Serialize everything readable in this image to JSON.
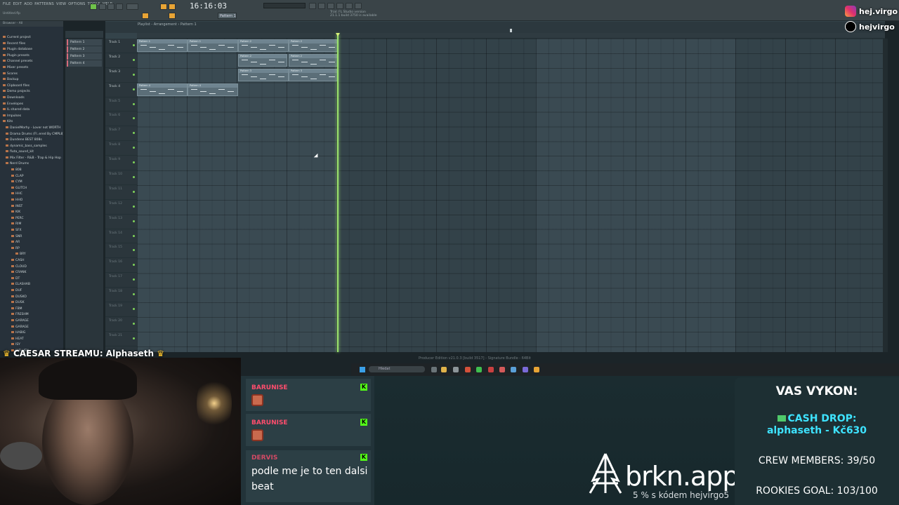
{
  "toolbar": {
    "menu": [
      "FILE",
      "EDIT",
      "ADD",
      "PATTERNS",
      "VIEW",
      "OPTIONS",
      "TOOLS",
      "HELP"
    ],
    "time": "16:16:03",
    "pattern_label": "Pattern 1",
    "project_label": "Untitled.flp",
    "hint_line1": "Trial: FL Studio version",
    "hint_line2": "21.1.1 build 3750 is available"
  },
  "playlist": {
    "title": "Playlist - Arrangement › Pattern 1",
    "status": "Producer Edition v21.0.3 [build 3517] - Signature Bundle - 64Bit"
  },
  "browser": {
    "header": "Browser - All",
    "items": [
      {
        "label": "Current project",
        "indent": 4
      },
      {
        "label": "Recent files",
        "indent": 4
      },
      {
        "label": "Plugin database",
        "indent": 4
      },
      {
        "label": "Plugin presets",
        "indent": 4
      },
      {
        "label": "Channel presets",
        "indent": 4
      },
      {
        "label": "Mixer presets",
        "indent": 4
      },
      {
        "label": "Scores",
        "indent": 4
      },
      {
        "label": "Backup",
        "indent": 4
      },
      {
        "label": "Clipboard files",
        "indent": 4
      },
      {
        "label": "Demo projects",
        "indent": 4
      },
      {
        "label": "Downloads",
        "indent": 4
      },
      {
        "label": "Envelopes",
        "indent": 4
      },
      {
        "label": "IL shared data",
        "indent": 4
      },
      {
        "label": "Impulses",
        "indent": 4
      },
      {
        "label": "Kits",
        "indent": 4
      },
      {
        "label": "DanielMorhy - Lover not WORTH",
        "indent": 8
      },
      {
        "label": "Drama Drums (Fl..ered By CMPL8)",
        "indent": 8
      },
      {
        "label": "Dundene BEST 808s",
        "indent": 8
      },
      {
        "label": "dynamic_bass_samples",
        "indent": 8
      },
      {
        "label": "fluta_sound_kit",
        "indent": 8
      },
      {
        "label": "Mix Filter - R&B - Trap & Hip Hop",
        "indent": 8
      },
      {
        "label": "Nerd Drums",
        "indent": 8
      },
      {
        "label": "808",
        "indent": 16
      },
      {
        "label": "CLAP",
        "indent": 16
      },
      {
        "label": "CYM",
        "indent": 16
      },
      {
        "label": "GLITCH",
        "indent": 16
      },
      {
        "label": "HHC",
        "indent": 16
      },
      {
        "label": "HHO",
        "indent": 16
      },
      {
        "label": "INST",
        "indent": 16
      },
      {
        "label": "KIK",
        "indent": 16
      },
      {
        "label": "PERC",
        "indent": 16
      },
      {
        "label": "RIM",
        "indent": 16
      },
      {
        "label": "SFX",
        "indent": 16
      },
      {
        "label": "SNR",
        "indent": 16
      },
      {
        "label": "AR",
        "indent": 16
      },
      {
        "label": "RP",
        "indent": 16
      },
      {
        "label": "BRY",
        "indent": 22
      },
      {
        "label": "CASH",
        "indent": 16
      },
      {
        "label": "CLOUD",
        "indent": 16
      },
      {
        "label": "CRANK",
        "indent": 16
      },
      {
        "label": "DT",
        "indent": 16
      },
      {
        "label": "ELASHAB",
        "indent": 16
      },
      {
        "label": "DUF",
        "indent": 16
      },
      {
        "label": "DUSKO",
        "indent": 16
      },
      {
        "label": "DUSK",
        "indent": 16
      },
      {
        "label": "FBM",
        "indent": 16
      },
      {
        "label": "FRESHM",
        "indent": 16
      },
      {
        "label": "GARAGE",
        "indent": 16
      },
      {
        "label": "GARAGE",
        "indent": 16
      },
      {
        "label": "HABIG",
        "indent": 16
      },
      {
        "label": "HEAT",
        "indent": 16
      },
      {
        "label": "ISY",
        "indent": 16
      },
      {
        "label": "INFLUEN",
        "indent": 16
      }
    ]
  },
  "patterns": [
    "Pattern 1",
    "Pattern 2",
    "Pattern 3",
    "Pattern 4"
  ],
  "tracks": [
    "Track 1",
    "Track 2",
    "Track 3",
    "Track 4",
    "Track 5",
    "Track 6",
    "Track 7",
    "Track 8",
    "Track 9",
    "Track 10",
    "Track 11",
    "Track 12",
    "Track 13",
    "Track 14",
    "Track 15",
    "Track 16",
    "Track 17",
    "Track 18",
    "Track 19",
    "Track 20",
    "Track 21"
  ],
  "clips": [
    {
      "label": "Pattern 1"
    },
    {
      "label": "Pattern 1"
    },
    {
      "label": "Pattern 2"
    },
    {
      "label": "Pattern 2"
    },
    {
      "label": "Pattern 2"
    },
    {
      "label": "Pattern 2"
    },
    {
      "label": "Pattern 3"
    },
    {
      "label": "Pattern 3"
    },
    {
      "label": "Pattern 4"
    },
    {
      "label": "Pattern 4"
    }
  ],
  "taskbar": {
    "search_placeholder": "Hledat"
  },
  "socials": {
    "instagram": "hej.virgo",
    "tiktok": "hejvirgo"
  },
  "stream": {
    "caesar": "CAESAR STREAMU: Alphaseth",
    "chat": [
      {
        "user": "BARUNISE",
        "type": "emote"
      },
      {
        "user": "BARUNISE",
        "type": "emote"
      },
      {
        "user": "DERVIS",
        "text": "podle me je to ten dalsi beat"
      }
    ],
    "brkn_name": "brkn.app",
    "brkn_promo": "5 % s kódem hejvirgo5",
    "panel": {
      "title": "VAS VYKON:",
      "cash_label": "CASH DROP:",
      "cash_value": "alphaseth - Kč630",
      "crew": "CREW MEMBERS: 39/50",
      "rookies": "ROOKIES GOAL: 103/100"
    }
  },
  "colors": {
    "playhead": "#9be26d",
    "accent": "#e8a435",
    "chat_user": "#ff4d6d",
    "cash": "#3ee3ff",
    "kick": "#53fc18"
  }
}
